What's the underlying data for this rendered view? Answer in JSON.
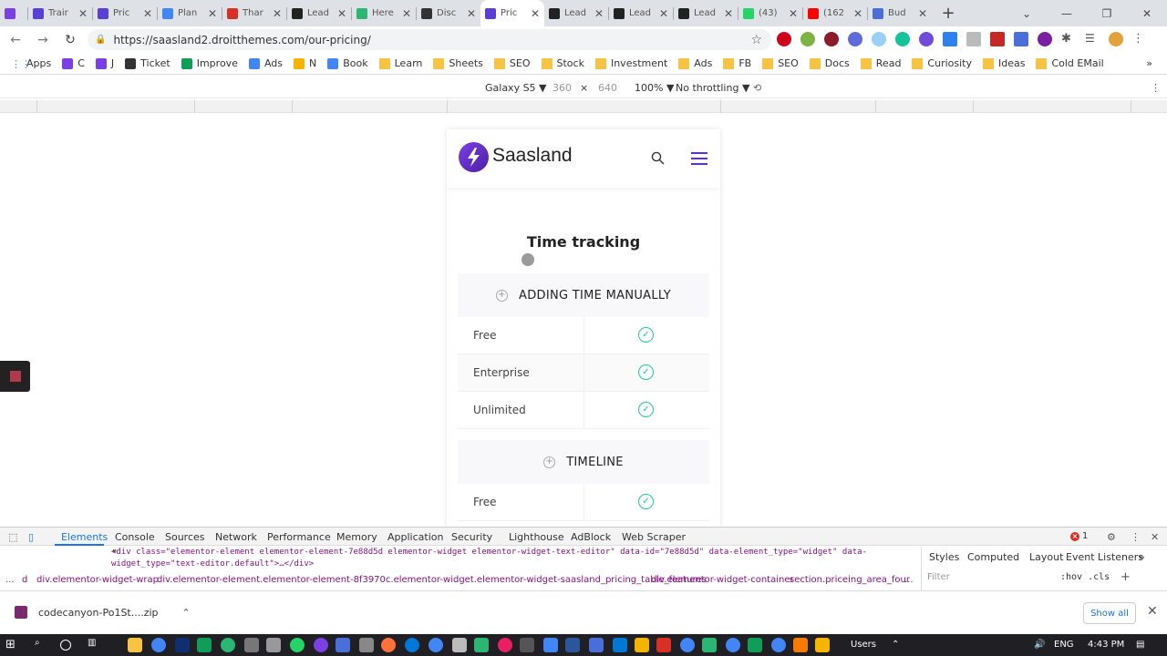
{
  "browser": {
    "tabs": [
      {
        "title": "",
        "color": "#7b3fe4"
      },
      {
        "title": "Trair",
        "color": "#5a3fd4"
      },
      {
        "title": "Pric",
        "color": "#5a3fd4"
      },
      {
        "title": "Plan",
        "color": "#4285f4"
      },
      {
        "title": "Thar",
        "color": "#d93025"
      },
      {
        "title": "Lead",
        "color": "#222222"
      },
      {
        "title": "Here",
        "color": "#2bb673"
      },
      {
        "title": "Disc",
        "color": "#333333"
      },
      {
        "title": "Pric",
        "color": "#5a3fd4",
        "active": true
      },
      {
        "title": "Lead",
        "color": "#222222"
      },
      {
        "title": "Lead",
        "color": "#222222"
      },
      {
        "title": "Lead",
        "color": "#222222"
      },
      {
        "title": "(43)",
        "color": "#25d366"
      },
      {
        "title": "(162",
        "color": "#ff0000"
      },
      {
        "title": "Bud",
        "color": "#4a6fd8"
      }
    ],
    "new_tab": "+",
    "url": "https://saasland2.droitthemes.com/our-pricing/",
    "bookmarks": [
      {
        "label": "Apps",
        "kind": "apps"
      },
      {
        "label": "C",
        "kind": "site",
        "color": "#7b3fe4"
      },
      {
        "label": "J",
        "kind": "site",
        "color": "#7b3fe4"
      },
      {
        "label": "Ticket",
        "kind": "site",
        "color": "#333333"
      },
      {
        "label": "Improve",
        "kind": "site",
        "color": "#0f9d58"
      },
      {
        "label": "Ads",
        "kind": "site",
        "color": "#4285f4"
      },
      {
        "label": "N",
        "kind": "site",
        "color": "#f4b400"
      },
      {
        "label": "Book",
        "kind": "site",
        "color": "#4285f4"
      },
      {
        "label": "Learn",
        "kind": "folder"
      },
      {
        "label": "Sheets",
        "kind": "folder"
      },
      {
        "label": "SEO",
        "kind": "folder"
      },
      {
        "label": "Stock",
        "kind": "folder"
      },
      {
        "label": "Investment",
        "kind": "folder"
      },
      {
        "label": "Ads",
        "kind": "folder"
      },
      {
        "label": "FB",
        "kind": "folder"
      },
      {
        "label": "SEO",
        "kind": "folder"
      },
      {
        "label": "Docs",
        "kind": "folder"
      },
      {
        "label": "Read",
        "kind": "folder"
      },
      {
        "label": "Curiosity",
        "kind": "folder"
      },
      {
        "label": "Ideas",
        "kind": "folder"
      },
      {
        "label": "Cold EMail",
        "kind": "folder"
      }
    ],
    "bookmarks_overflow": "»"
  },
  "device_toolbar": {
    "device": "Galaxy S5 ▼",
    "width": "360",
    "times": "×",
    "height": "640",
    "zoom": "100% ▼",
    "throttling": "No throttling ▼"
  },
  "site": {
    "logo_text": "Saasland",
    "section_title": "Time tracking",
    "groups": [
      {
        "title": "ADDING TIME MANUALLY",
        "rows": [
          {
            "plan": "Free"
          },
          {
            "plan": "Enterprise"
          },
          {
            "plan": "Unlimited"
          }
        ]
      },
      {
        "title": "TIMELINE",
        "rows": [
          {
            "plan": "Free"
          }
        ]
      }
    ],
    "brand_color": "#5e2ced",
    "check_color": "#23c99a"
  },
  "devtools": {
    "tabs": [
      "Elements",
      "Console",
      "Sources",
      "Network",
      "Performance",
      "Memory",
      "Application",
      "Security",
      "Lighthouse",
      "AdBlock",
      "Web Scraper"
    ],
    "active_tab": "Elements",
    "error_count": "1",
    "code_line_1": "<div class=\"elementor-element elementor-element-7e88d5d elementor-widget elementor-widget-text-editor\" data-id=\"7e88d5d\" data-element_type=\"widget\" data-",
    "code_line_2": "widget_type=\"text-editor.default\">…</div>",
    "breadcrumbs": [
      "...",
      "d",
      "div.elementor-widget-wrap",
      "div.elementor-element.elementor-element-8f3970c.elementor-widget.elementor-widget-saasland_pricing_table_features",
      "div.elementor-widget-container",
      "section.priceing_area_four",
      "..."
    ],
    "styles_tabs": [
      "Styles",
      "Computed",
      "Layout",
      "Event Listeners",
      "»"
    ],
    "filter_placeholder": "Filter",
    "hov_cls": ":hov .cls"
  },
  "downloads": {
    "file": "codecanyon-Po1St....zip",
    "show_all": "Show all"
  },
  "taskbar": {
    "users": "Users",
    "language": "ENG",
    "time": "4:43 PM"
  }
}
